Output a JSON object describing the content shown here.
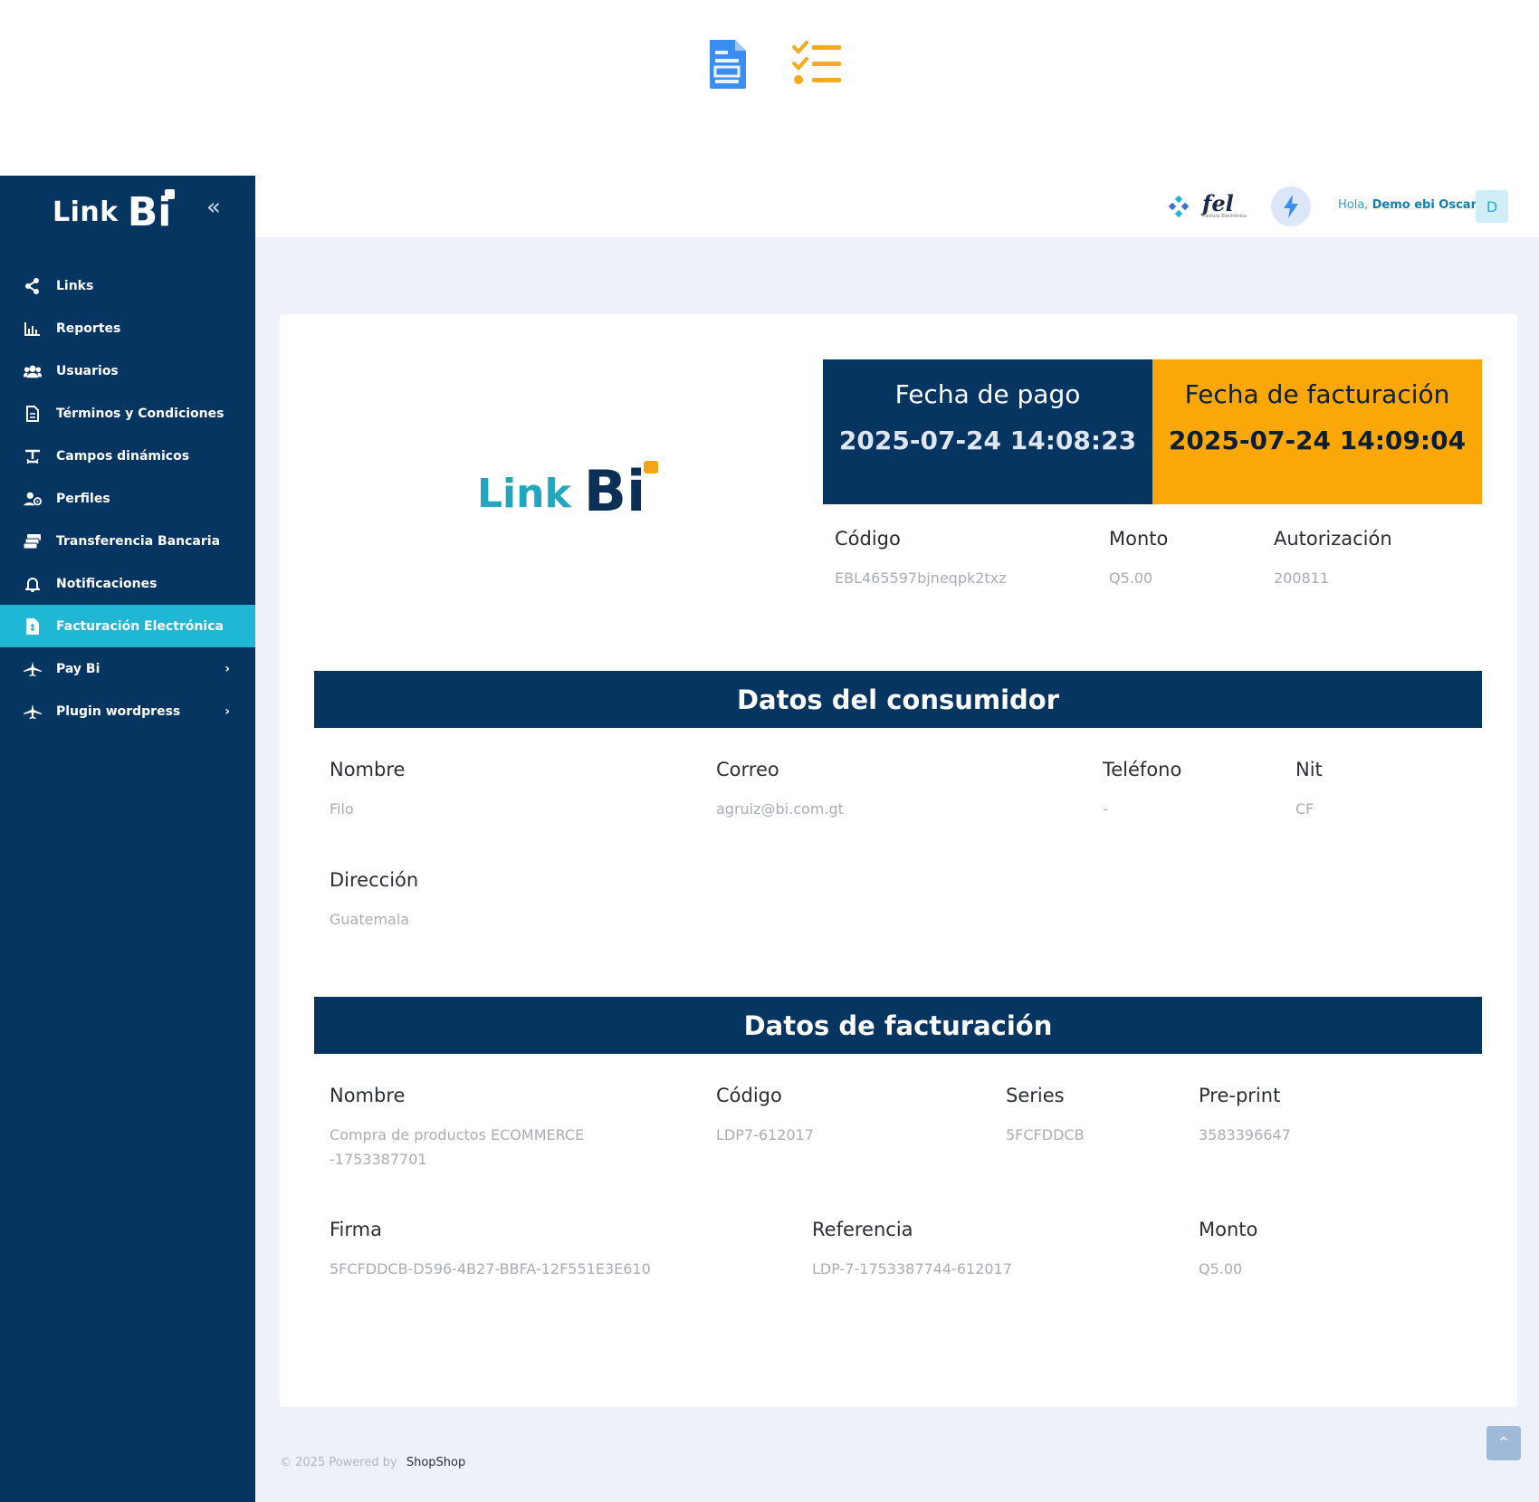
{
  "sidebar": {
    "brand_link": "Link",
    "brand_bi": "Bi",
    "collapse_icon": "double-chevron-left-icon",
    "items": [
      {
        "label": "Links",
        "icon": "share-icon"
      },
      {
        "label": "Reportes",
        "icon": "bar-chart-icon"
      },
      {
        "label": "Usuarios",
        "icon": "users-icon"
      },
      {
        "label": "Términos y Condiciones",
        "icon": "document-icon"
      },
      {
        "label": "Campos dinámicos",
        "icon": "text-format-icon"
      },
      {
        "label": "Perfiles",
        "icon": "user-gear-icon"
      },
      {
        "label": "Transferencia Bancaria",
        "icon": "cash-stack-icon"
      },
      {
        "label": "Notificaciones",
        "icon": "bell-icon"
      },
      {
        "label": "Facturación Electrónica",
        "icon": "invoice-icon",
        "active": true
      },
      {
        "label": "Pay Bi",
        "icon": "plane-icon",
        "has_submenu": true
      },
      {
        "label": "Plugin wordpress",
        "icon": "plane-icon",
        "has_submenu": true
      }
    ]
  },
  "header": {
    "fel_logo": "fel",
    "fel_sub": "Factura Electrónica",
    "greeting_prefix": "Hola,",
    "user_name": "Demo ebi Oscar",
    "avatar_initial": "D"
  },
  "receipt": {
    "logo_link": "Link",
    "logo_bi": "Bi",
    "pay_date_label": "Fecha de pago",
    "pay_date_value": "2025-07-24 14:08:23",
    "invoice_date_label": "Fecha de facturación",
    "invoice_date_value": "2025-07-24 14:09:04",
    "codigo_label": "Código",
    "codigo_value": "EBL465597bjneqpk2txz",
    "monto_label": "Monto",
    "monto_value": "Q5.00",
    "autorizacion_label": "Autorización",
    "autorizacion_value": "200811"
  },
  "consumer": {
    "title": "Datos del consumidor",
    "nombre_label": "Nombre",
    "nombre_value": "Filo",
    "correo_label": "Correo",
    "correo_value": "agruiz@bi.com.gt",
    "telefono_label": "Teléfono",
    "telefono_value": "-",
    "nit_label": "Nit",
    "nit_value": "CF",
    "direccion_label": "Dirección",
    "direccion_value": "Guatemala"
  },
  "billing": {
    "title": "Datos de facturación",
    "nombre_label": "Nombre",
    "nombre_value_line1": "Compra de productos ECOMMERCE",
    "nombre_value_line2": "-1753387701",
    "codigo_label": "Código",
    "codigo_value": "LDP7-612017",
    "series_label": "Series",
    "series_value": "5FCFDDCB",
    "preprint_label": "Pre-print",
    "preprint_value": "3583396647",
    "firma_label": "Firma",
    "firma_value": "5FCFDDCB-D596-4B27-BBFA-12F551E3E610",
    "referencia_label": "Referencia",
    "referencia_value": "LDP-7-1753387744-612017",
    "monto_label": "Monto",
    "monto_value": "Q5.00"
  },
  "footer": {
    "copyright": "© 2025 Powered by",
    "brand": "ShopShop"
  },
  "colors": {
    "navy": "#063562",
    "accent": "#1fb7d3",
    "orange": "#fba707"
  }
}
